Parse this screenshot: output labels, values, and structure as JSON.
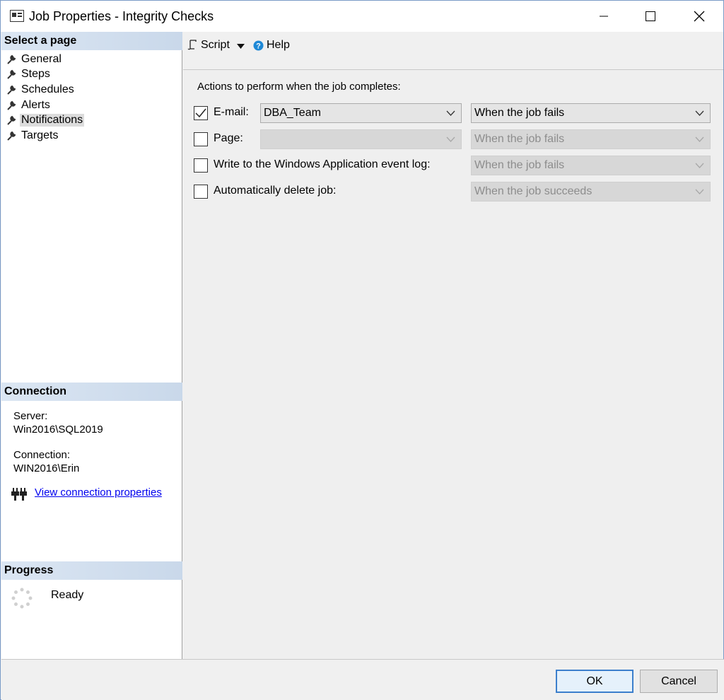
{
  "window": {
    "title": "Job Properties - Integrity Checks"
  },
  "sidebar": {
    "select_page_header": "Select a page",
    "items": [
      {
        "label": "General"
      },
      {
        "label": "Steps"
      },
      {
        "label": "Schedules"
      },
      {
        "label": "Alerts"
      },
      {
        "label": "Notifications",
        "selected": true
      },
      {
        "label": "Targets"
      }
    ],
    "connection_header": "Connection",
    "server_label": "Server:",
    "server_value": "Win2016\\SQL2019",
    "connection_label": "Connection:",
    "connection_value": "WIN2016\\Erin",
    "view_connection_link": "View connection properties",
    "progress_header": "Progress",
    "progress_status": "Ready"
  },
  "toolbar": {
    "script_label": "Script",
    "help_label": "Help"
  },
  "notifications": {
    "actions_label": "Actions to perform when the job completes:",
    "email": {
      "label": "E-mail:",
      "checked": true,
      "operator": "DBA_Team",
      "condition": "When the job fails"
    },
    "page": {
      "label": "Page:",
      "checked": false,
      "operator": "",
      "condition": "When the job fails"
    },
    "eventlog": {
      "label": "Write to the Windows Application event log:",
      "checked": false,
      "condition": "When the job fails"
    },
    "delete": {
      "label": "Automatically delete job:",
      "checked": false,
      "condition": "When the job succeeds"
    }
  },
  "buttons": {
    "ok_label": "OK",
    "cancel_label": "Cancel"
  },
  "colors": {
    "accent": "#3c7fcc",
    "header_bg": "#c9d8ea",
    "link": "#0000ee"
  }
}
